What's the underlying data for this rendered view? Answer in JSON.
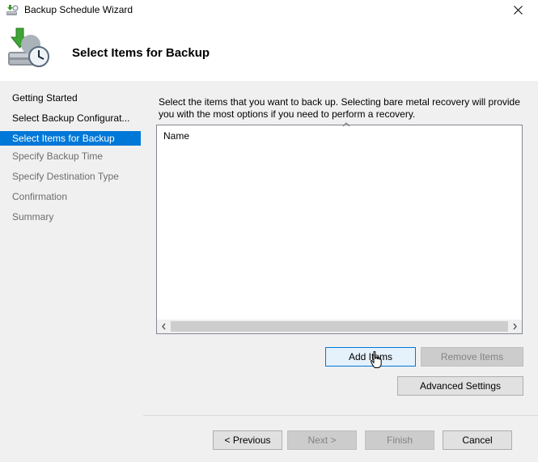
{
  "window": {
    "title": "Backup Schedule Wizard",
    "icons": {
      "app": "backup-app-icon",
      "close": "close-icon"
    }
  },
  "header": {
    "title": "Select Items for Backup",
    "icon": "backup-schedule-icon"
  },
  "nav": {
    "items": [
      {
        "label": "Getting Started",
        "state": "done"
      },
      {
        "label": "Select Backup Configurat...",
        "state": "done"
      },
      {
        "label": "Select Items for Backup",
        "state": "active"
      },
      {
        "label": "Specify Backup Time",
        "state": "pending"
      },
      {
        "label": "Specify Destination Type",
        "state": "pending"
      },
      {
        "label": "Confirmation",
        "state": "pending"
      },
      {
        "label": "Summary",
        "state": "pending"
      }
    ]
  },
  "content": {
    "description": "Select the items that you want to back up. Selecting bare metal recovery will provide you with the most options if you need to perform a recovery.",
    "list": {
      "column_header": "Name",
      "rows": []
    },
    "buttons": {
      "add_items": "Add Items",
      "remove_items": "Remove Items",
      "advanced_settings": "Advanced Settings"
    }
  },
  "footer": {
    "previous": "< Previous",
    "next": "Next >",
    "finish": "Finish",
    "cancel": "Cancel"
  },
  "colors": {
    "accent": "#0078d7",
    "panel": "#f0f0f0",
    "disabled_text": "#838383"
  }
}
